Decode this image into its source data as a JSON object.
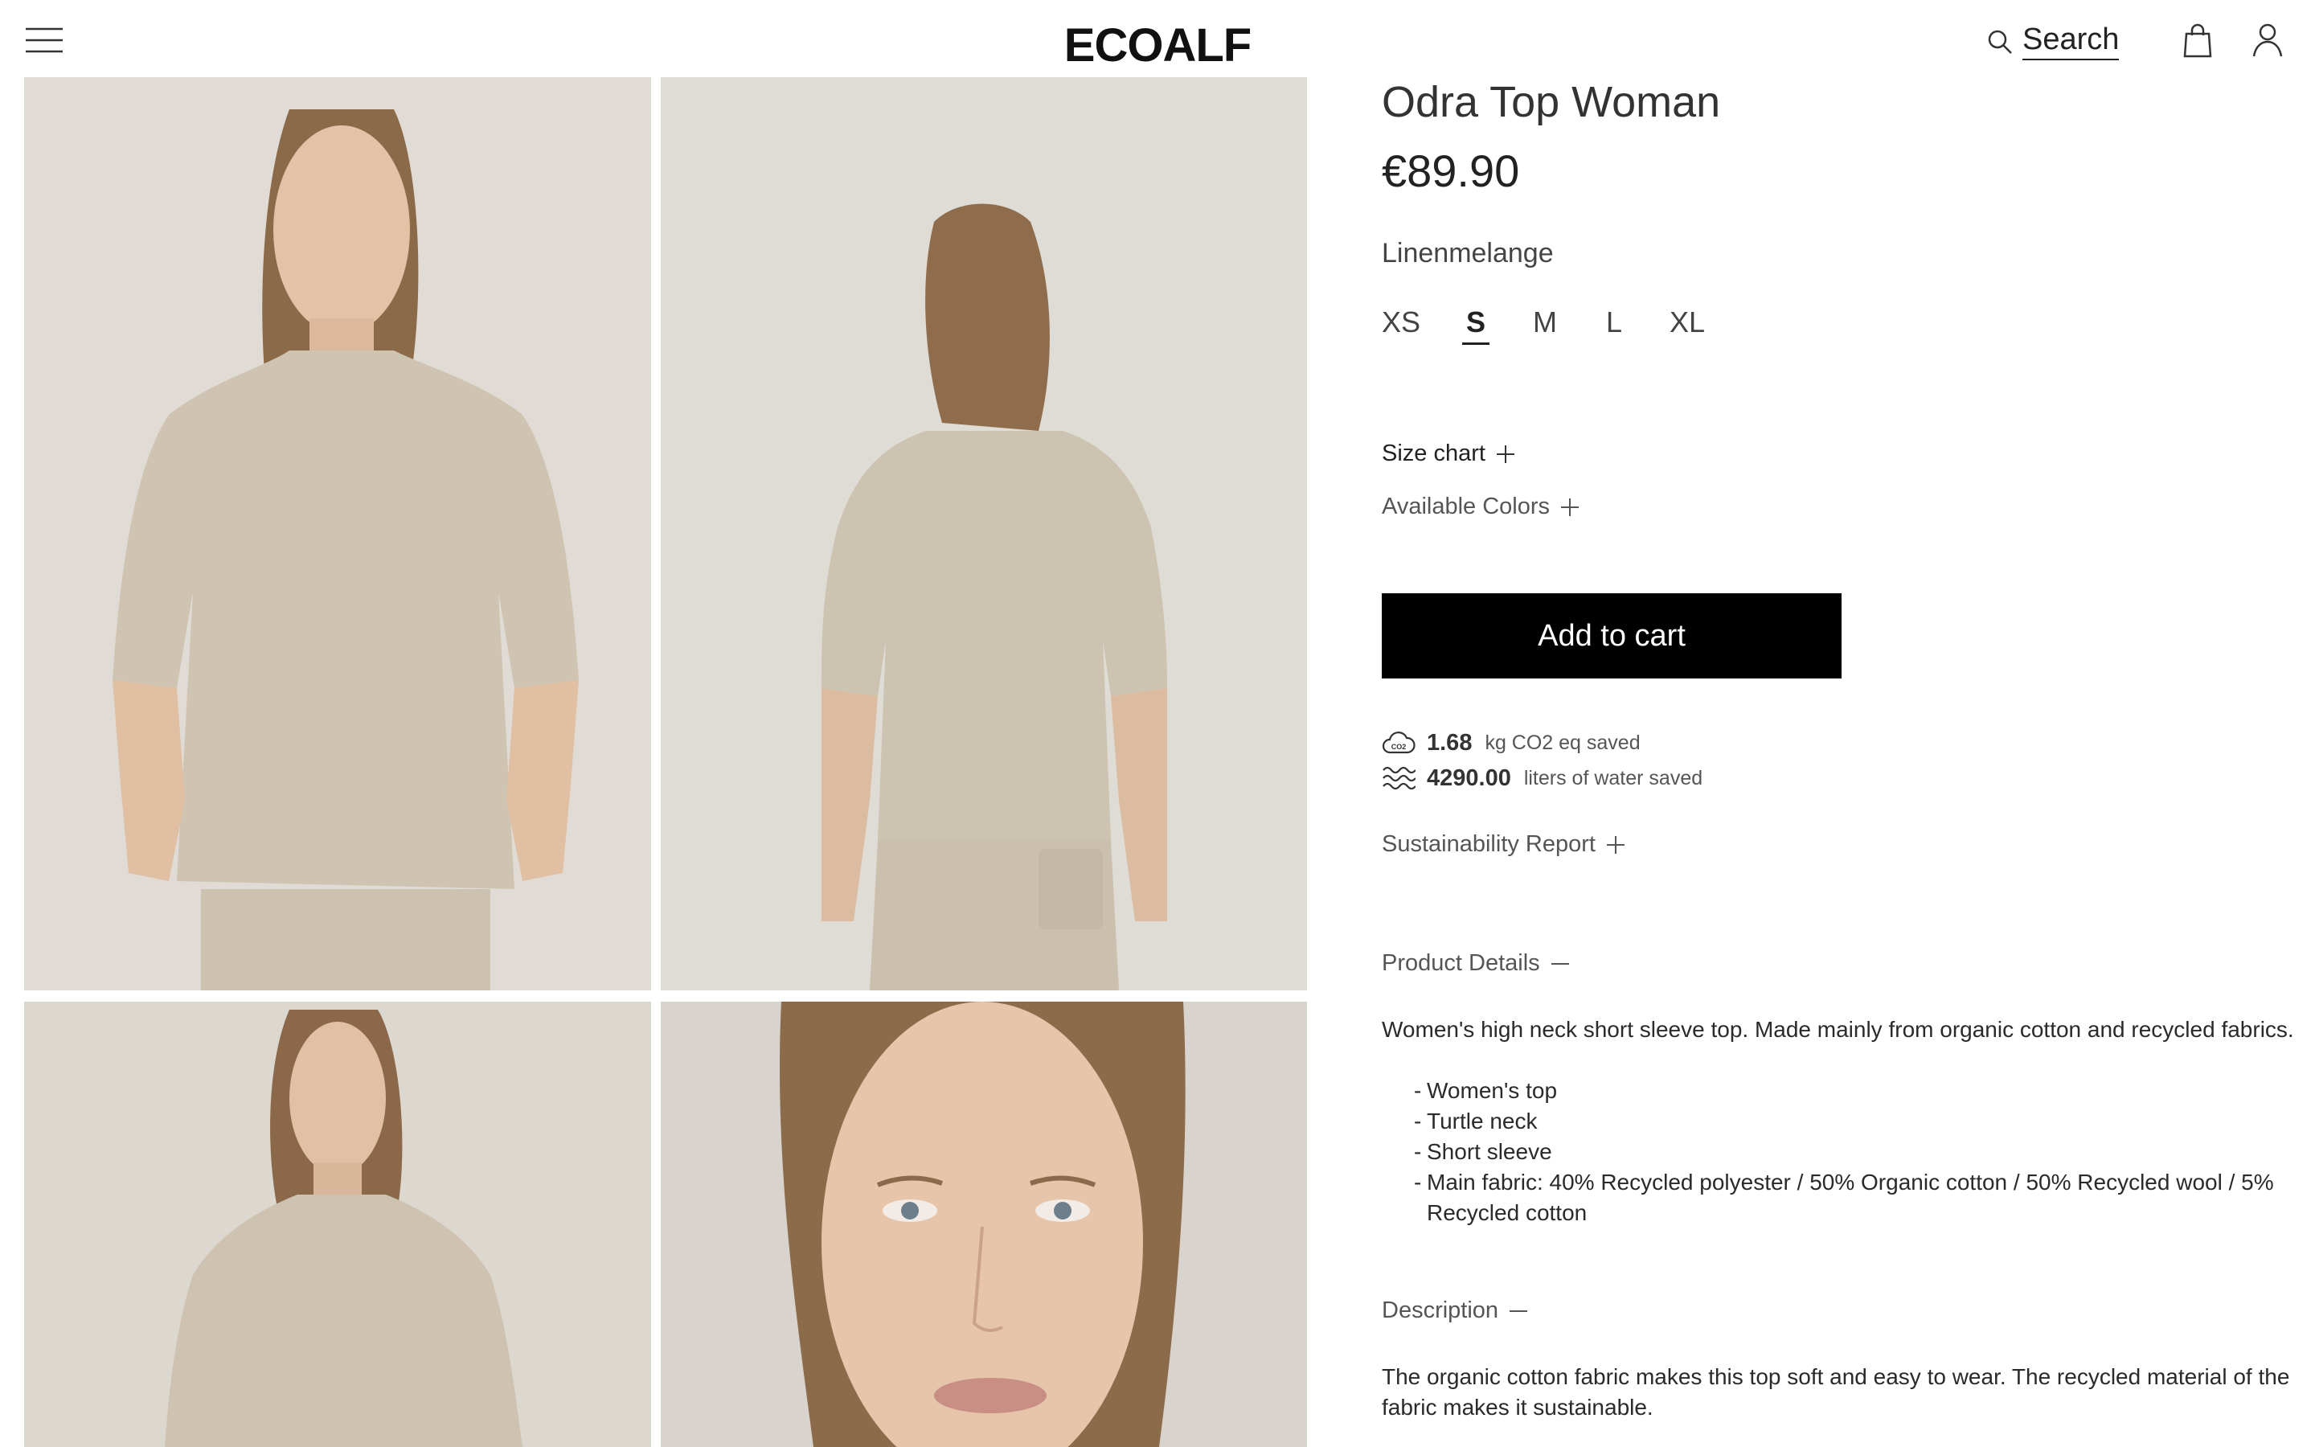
{
  "header": {
    "logo_text": "ECOALF",
    "search_label": "Search",
    "icons": {
      "menu": "hamburger-menu-icon",
      "search": "search-icon",
      "bag": "shopping-bag-icon",
      "account": "user-icon"
    }
  },
  "gallery": {
    "images": [
      {
        "name": "front-view"
      },
      {
        "name": "back-view"
      },
      {
        "name": "side-view"
      },
      {
        "name": "face-closeup"
      }
    ]
  },
  "product": {
    "title": "Odra Top Woman",
    "price": "€89.90",
    "color": "Linenmelange",
    "sizes": [
      "XS",
      "S",
      "M",
      "L",
      "XL"
    ],
    "selected_size": "S",
    "size_chart_label": "Size chart",
    "available_colors_label": "Available Colors",
    "add_to_cart_label": "Add to cart",
    "sustainability": {
      "co2_value": "1.68",
      "co2_label": "kg CO2 eq saved",
      "water_value": "4290.00",
      "water_label": "liters of water saved",
      "report_label": "Sustainability Report"
    },
    "details": {
      "heading": "Product Details",
      "text": "Women's high neck short sleeve top. Made mainly from organic cotton and recycled fabrics.",
      "bullets": [
        "Women's top",
        "Turtle neck",
        "Short sleeve",
        "Main fabric: 40% Recycled polyester / 50% Organic cotton / 50% Recycled wool / 5% Recycled cotton"
      ]
    },
    "description": {
      "heading": "Description",
      "text": "The organic cotton fabric makes this top soft and easy to wear. The recycled material of the fabric makes it sustainable."
    }
  },
  "colors": {
    "background": "#ffffff",
    "text": "#1e1e1e",
    "button_bg": "#000000",
    "button_text": "#ffffff",
    "photo_backdrop": "#dcd7d0",
    "garment": "#cfc4b2"
  }
}
